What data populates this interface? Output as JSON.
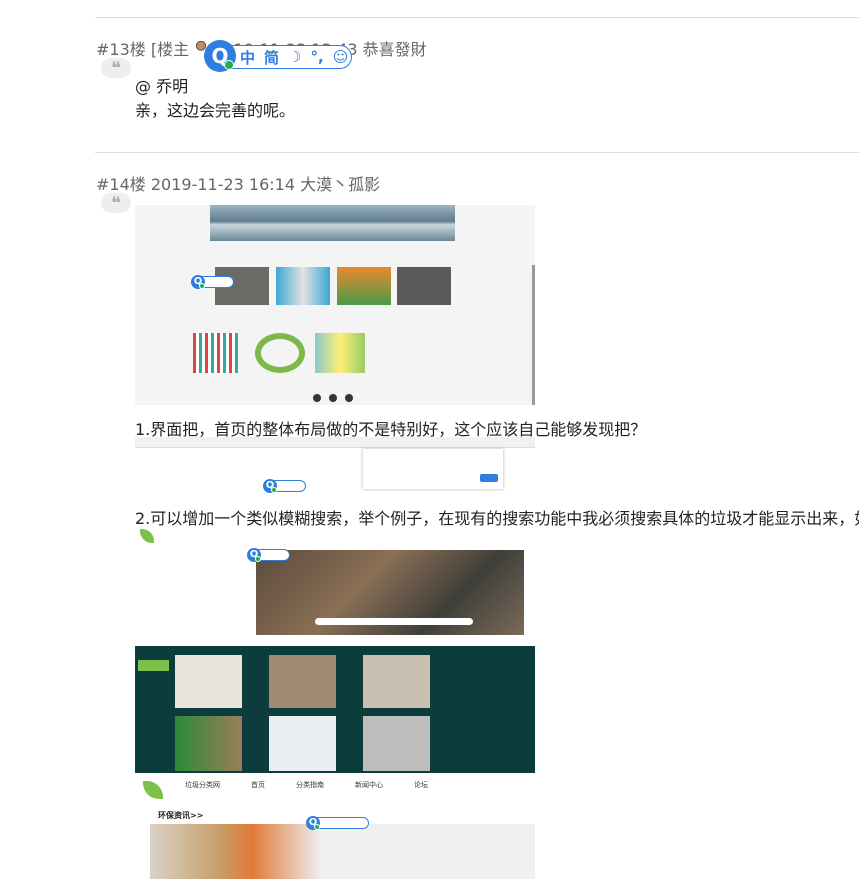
{
  "post13": {
    "floor": "#13楼",
    "bracket_open": "[楼主",
    "date_time": "2019-11-23 13:43",
    "author": "恭喜發財",
    "reply_to": "@ 乔明",
    "content": "亲，这边会完善的呢。"
  },
  "post14": {
    "header": "#14楼 2019-11-23 16:14 大漠丶孤影",
    "point1": "1.界面把，首页的整体布局做的不是特别好，这个应该自己能够发现把？",
    "point2": "2.可以增加一个类似模糊搜索，举个例子，在现有的搜索功能中我必须搜索具体的垃圾才能显示出来，如",
    "screenshot_nav": {
      "items": [
        "垃圾分类网",
        "首页",
        "分类指南",
        "新闻中心",
        "论坛"
      ],
      "section_title": "环保资讯>>"
    }
  },
  "ime": {
    "labels": [
      "中",
      "简",
      "☽",
      "°,",
      "☺"
    ],
    "logo_letter": "Q"
  },
  "colors": {
    "accent_blue": "#2e7de1",
    "dark_teal": "#0d3c3c",
    "leaf_green": "#7cc24a"
  }
}
